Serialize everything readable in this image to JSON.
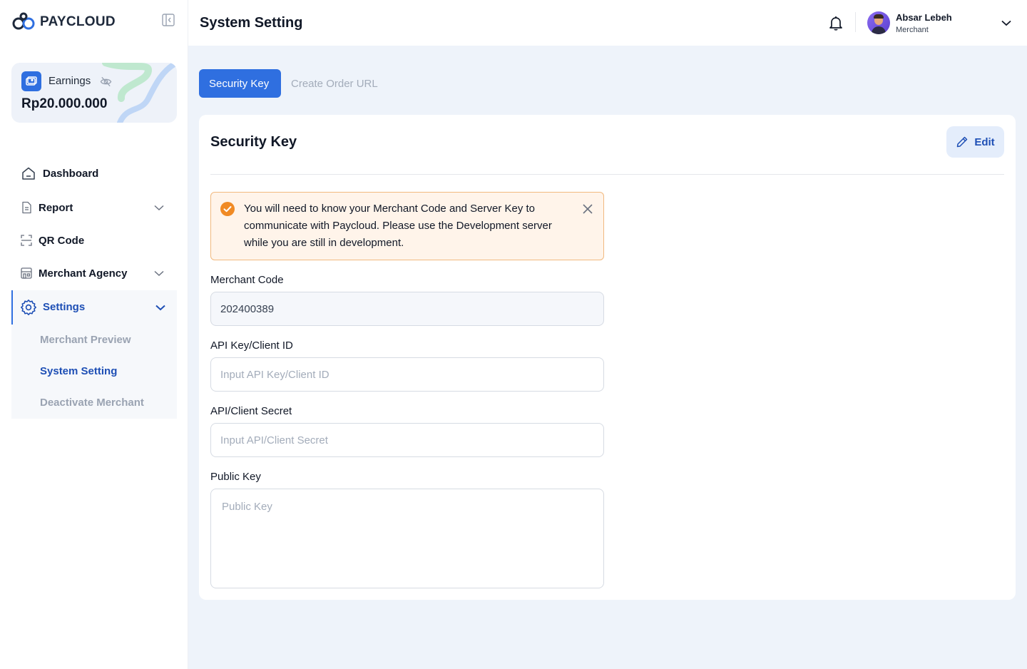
{
  "brand": {
    "name": "PAYCLOUD"
  },
  "earnings": {
    "label": "Earnings",
    "value": "Rp20.000.000"
  },
  "nav": {
    "dashboard": "Dashboard",
    "report": "Report",
    "qr_code": "QR Code",
    "merchant_agency": "Merchant Agency",
    "settings": "Settings",
    "settings_sub": [
      "Merchant Preview",
      "System Setting",
      "Deactivate Merchant"
    ]
  },
  "header": {
    "title": "System Setting"
  },
  "user": {
    "name": "Absar Lebeh",
    "role": "Merchant"
  },
  "tabs": [
    "Security Key",
    "Create Order URL"
  ],
  "card": {
    "title": "Security Key",
    "edit_label": "Edit",
    "alert": "You will need to know your Merchant Code and Server Key to communicate with Paycloud. Please use the Development server while you are still in development."
  },
  "form": {
    "merchant_code": {
      "label": "Merchant Code",
      "value": "202400389"
    },
    "api_key": {
      "label": "API Key/Client ID",
      "placeholder": "Input API Key/Client ID"
    },
    "api_secret": {
      "label": "API/Client Secret",
      "placeholder": "Input API/Client Secret"
    },
    "public_key": {
      "label": "Public Key",
      "placeholder": "Public Key"
    }
  },
  "colors": {
    "primary": "#2f6fe0",
    "accent_text": "#1e4fb5",
    "alert_border": "#f1b97f",
    "alert_bg": "#fff4ea",
    "alert_icon": "#f08a24"
  },
  "icons": [
    "paycloud-logo-icon",
    "sidebar-collapse-icon",
    "wallet-icon",
    "eye-off-icon",
    "home-icon",
    "document-icon",
    "qr-scan-icon",
    "building-icon",
    "gear-icon",
    "chevron-down-icon",
    "bell-icon",
    "pencil-icon",
    "check-circle-icon",
    "close-icon"
  ]
}
